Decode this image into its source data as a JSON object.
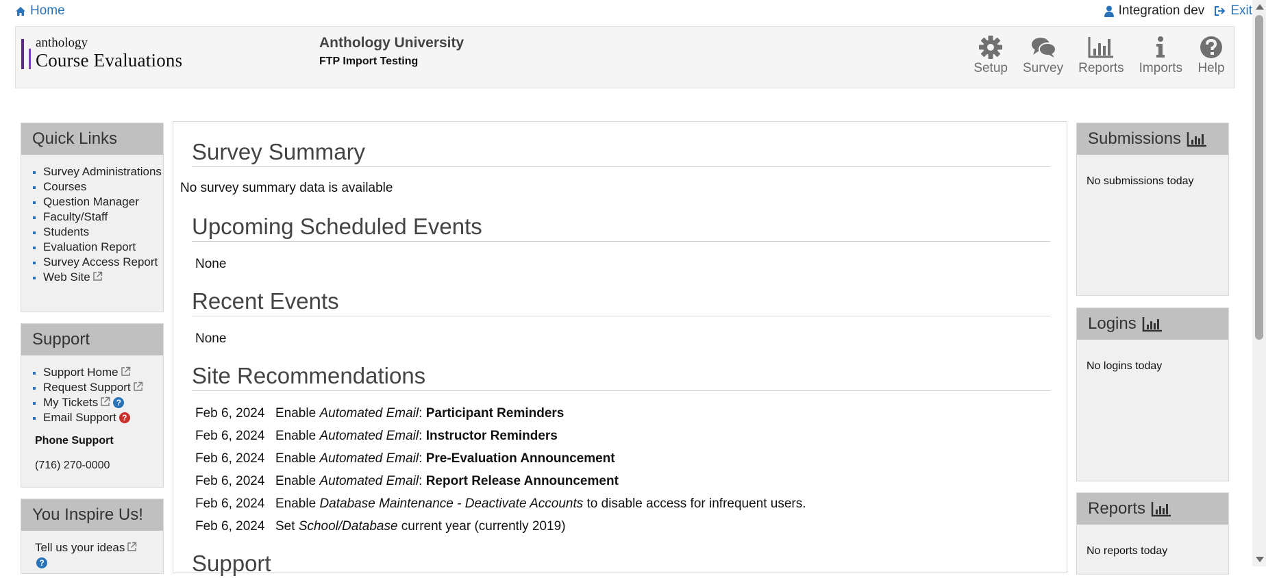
{
  "topbar": {
    "home_label": "Home",
    "user_name": "Integration dev",
    "exit_label": "Exit"
  },
  "header": {
    "logo_small": "anthology",
    "logo_big": "Course Evaluations",
    "institution": "Anthology University",
    "subtitle": "FTP Import Testing",
    "nav": [
      "Setup",
      "Survey",
      "Reports",
      "Imports",
      "Help"
    ]
  },
  "quick_links": {
    "title": "Quick Links",
    "items": [
      "Survey Administrations",
      "Courses",
      "Question Manager",
      "Faculty/Staff",
      "Students",
      "Evaluation Report",
      "Survey Access Report",
      "Web Site"
    ]
  },
  "support": {
    "title": "Support",
    "items": [
      "Support Home",
      "Request Support",
      "My Tickets",
      "Email Support"
    ],
    "phone_label": "Phone Support",
    "phone": "(716) 270-0000"
  },
  "inspire": {
    "title": "You Inspire Us!",
    "text": "Tell us your ideas"
  },
  "main": {
    "survey_summary_title": "Survey Summary",
    "survey_summary_text": "No survey summary data is available",
    "upcoming_title": "Upcoming Scheduled Events",
    "upcoming_text": "None",
    "recent_title": "Recent Events",
    "recent_text": "None",
    "recs_title": "Site Recommendations",
    "recs": [
      {
        "date": "Feb 6, 2024",
        "pre": "Enable ",
        "em": "Automated Email",
        "sep": ": ",
        "strong": "Participant Reminders",
        "post": ""
      },
      {
        "date": "Feb 6, 2024",
        "pre": "Enable ",
        "em": "Automated Email",
        "sep": ": ",
        "strong": "Instructor Reminders",
        "post": ""
      },
      {
        "date": "Feb 6, 2024",
        "pre": "Enable ",
        "em": "Automated Email",
        "sep": ": ",
        "strong": "Pre-Evaluation Announcement",
        "post": ""
      },
      {
        "date": "Feb 6, 2024",
        "pre": "Enable ",
        "em": "Automated Email",
        "sep": ": ",
        "strong": "Report Release Announcement",
        "post": ""
      },
      {
        "date": "Feb 6, 2024",
        "pre": "Enable ",
        "em": "Database Maintenance - Deactivate Accounts",
        "sep": "",
        "strong": "",
        "post": " to disable access for infrequent users."
      },
      {
        "date": "Feb 6, 2024",
        "pre": "Set ",
        "em": "School/Database",
        "sep": "",
        "strong": "",
        "post": " current year (currently 2019)"
      }
    ],
    "support_title": "Support"
  },
  "right": {
    "submissions_title": "Submissions",
    "submissions_text": "No submissions today",
    "logins_title": "Logins",
    "logins_text": "No logins today",
    "reports_title": "Reports",
    "reports_text": "No reports today"
  },
  "colors": {
    "link": "#2a73b8",
    "panel_head": "#c0c0c0",
    "logo_purple": "#5b2a86"
  }
}
